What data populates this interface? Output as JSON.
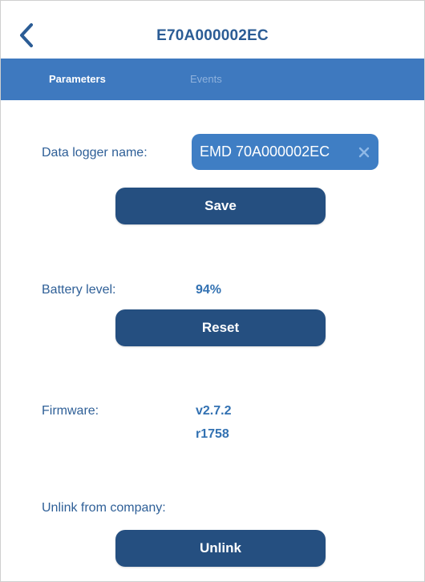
{
  "header": {
    "title": "E70A000002EC",
    "back_icon": "chevron-left-icon"
  },
  "tabs": [
    {
      "label": "Parameters",
      "active": true
    },
    {
      "label": "Events",
      "active": false
    }
  ],
  "colors": {
    "accent": "#3e79bf",
    "button": "#254f80",
    "title": "#2b5c95"
  },
  "logger_name": {
    "label": "Data logger name:",
    "value": "EMD 70A000002EC"
  },
  "save_label": "Save",
  "battery": {
    "label": "Battery level:",
    "value": "94%"
  },
  "reset_label": "Reset",
  "firmware": {
    "label": "Firmware:",
    "version": "v2.7.2",
    "revision": "r1758"
  },
  "unlink": {
    "label": "Unlink from company:",
    "button": "Unlink"
  }
}
